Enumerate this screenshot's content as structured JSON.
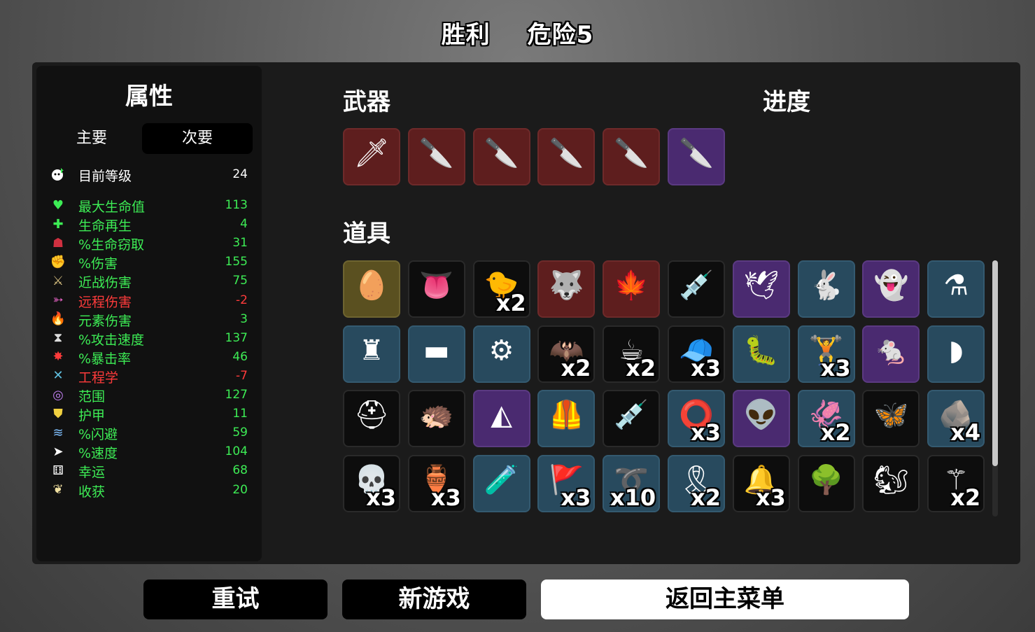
{
  "header": {
    "result": "胜利",
    "danger": "危险5"
  },
  "stats": {
    "title": "属性",
    "tabs": {
      "main": "主要",
      "secondary": "次要"
    },
    "level": {
      "icon": "level-icon",
      "label": "目前等级",
      "value": "24"
    },
    "rows": [
      {
        "icon": "heart-icon",
        "label": "最大生命值",
        "value": "113",
        "color": "#3dec55"
      },
      {
        "icon": "regen-icon",
        "label": "生命再生",
        "value": "4",
        "color": "#3dec55"
      },
      {
        "icon": "lifesteal-icon",
        "label": "%生命窃取",
        "value": "31",
        "color": "#3dec55"
      },
      {
        "icon": "damage-icon",
        "label": "%伤害",
        "value": "155",
        "color": "#3dec55"
      },
      {
        "icon": "melee-icon",
        "label": "近战伤害",
        "value": "75",
        "color": "#3dec55"
      },
      {
        "icon": "ranged-icon",
        "label": "远程伤害",
        "value": "-2",
        "color": "#ff3b3b"
      },
      {
        "icon": "elemental-icon",
        "label": "元素伤害",
        "value": "3",
        "color": "#3dec55"
      },
      {
        "icon": "attack-speed-icon",
        "label": "%攻击速度",
        "value": "137",
        "color": "#3dec55"
      },
      {
        "icon": "crit-icon",
        "label": "%暴击率",
        "value": "46",
        "color": "#3dec55"
      },
      {
        "icon": "engineering-icon",
        "label": "工程学",
        "value": "-7",
        "color": "#ff3b3b"
      },
      {
        "icon": "range-icon",
        "label": "范围",
        "value": "127",
        "color": "#3dec55"
      },
      {
        "icon": "armor-icon",
        "label": "护甲",
        "value": "11",
        "color": "#3dec55"
      },
      {
        "icon": "dodge-icon",
        "label": "%闪避",
        "value": "59",
        "color": "#3dec55"
      },
      {
        "icon": "speed-icon",
        "label": "%速度",
        "value": "104",
        "color": "#3dec55"
      },
      {
        "icon": "luck-icon",
        "label": "幸运",
        "value": "68",
        "color": "#3dec55"
      },
      {
        "icon": "harvest-icon",
        "label": "收获",
        "value": "20",
        "color": "#3dec55"
      }
    ]
  },
  "weapons_title": "武器",
  "progress_title": "进度",
  "items_title": "道具",
  "weapons": [
    {
      "name": "dagger-icon",
      "tier": 3
    },
    {
      "name": "knife-icon",
      "tier": 3
    },
    {
      "name": "knife-icon",
      "tier": 3
    },
    {
      "name": "knife-icon",
      "tier": 3
    },
    {
      "name": "knife-icon",
      "tier": 3
    },
    {
      "name": "knife-icon",
      "tier": 2
    }
  ],
  "items": [
    {
      "name": "egg-icon",
      "tier": "gold",
      "qty": ""
    },
    {
      "name": "tongue-icon",
      "tier": 0,
      "qty": ""
    },
    {
      "name": "duck-icon",
      "tier": 0,
      "qty": "x2"
    },
    {
      "name": "wolf-icon",
      "tier": 3,
      "qty": ""
    },
    {
      "name": "rainbow-leaf-icon",
      "tier": 3,
      "qty": ""
    },
    {
      "name": "syringe-icon",
      "tier": 0,
      "qty": ""
    },
    {
      "name": "wings-icon",
      "tier": 2,
      "qty": ""
    },
    {
      "name": "rabbit-icon",
      "tier": 1,
      "qty": ""
    },
    {
      "name": "ghost-icon",
      "tier": 2,
      "qty": ""
    },
    {
      "name": "potion-shelf-icon",
      "tier": 1,
      "qty": ""
    },
    {
      "name": "turret-icon",
      "tier": 1,
      "qty": ""
    },
    {
      "name": "scarf-icon",
      "tier": 1,
      "qty": ""
    },
    {
      "name": "machine-icon",
      "tier": 1,
      "qty": ""
    },
    {
      "name": "bat-icon",
      "tier": 0,
      "qty": "x2"
    },
    {
      "name": "coffee-icon",
      "tier": 0,
      "qty": "x2"
    },
    {
      "name": "propeller-hat-icon",
      "tier": 0,
      "qty": "x3"
    },
    {
      "name": "worm-icon",
      "tier": 1,
      "qty": ""
    },
    {
      "name": "dumbbell-icon",
      "tier": 1,
      "qty": "x3"
    },
    {
      "name": "mouse-icon",
      "tier": 2,
      "qty": ""
    },
    {
      "name": "blade-icon",
      "tier": 1,
      "qty": ""
    },
    {
      "name": "beanie-icon",
      "tier": 0,
      "qty": ""
    },
    {
      "name": "hedgehog-icon",
      "tier": 0,
      "qty": ""
    },
    {
      "name": "shark-fin-icon",
      "tier": 2,
      "qty": ""
    },
    {
      "name": "vest-icon",
      "tier": 1,
      "qty": ""
    },
    {
      "name": "blood-syringe-icon",
      "tier": 0,
      "qty": ""
    },
    {
      "name": "lifebuoy-icon",
      "tier": 1,
      "qty": "x3"
    },
    {
      "name": "alien-icon",
      "tier": 2,
      "qty": ""
    },
    {
      "name": "tentacles-icon",
      "tier": 1,
      "qty": "x2"
    },
    {
      "name": "butterfly-icon",
      "tier": 0,
      "qty": ""
    },
    {
      "name": "rock-icon",
      "tier": 1,
      "qty": "x4"
    },
    {
      "name": "skull-icon",
      "tier": 0,
      "qty": "x3"
    },
    {
      "name": "jar-icon",
      "tier": 0,
      "qty": "x3"
    },
    {
      "name": "flask-icon",
      "tier": 1,
      "qty": ""
    },
    {
      "name": "banner-icon",
      "tier": 1,
      "qty": "x3"
    },
    {
      "name": "lasso-icon",
      "tier": 1,
      "qty": "x10"
    },
    {
      "name": "belt-icon",
      "tier": 1,
      "qty": "x2"
    },
    {
      "name": "bell-icon",
      "tier": 0,
      "qty": "x3"
    },
    {
      "name": "tree-icon",
      "tier": 0,
      "qty": ""
    },
    {
      "name": "lumberjack-icon",
      "tier": 0,
      "qty": ""
    },
    {
      "name": "scythe-icon",
      "tier": 0,
      "qty": "x2"
    }
  ],
  "buttons": {
    "retry": "重试",
    "new_game": "新游戏",
    "main_menu": "返回主菜单"
  }
}
